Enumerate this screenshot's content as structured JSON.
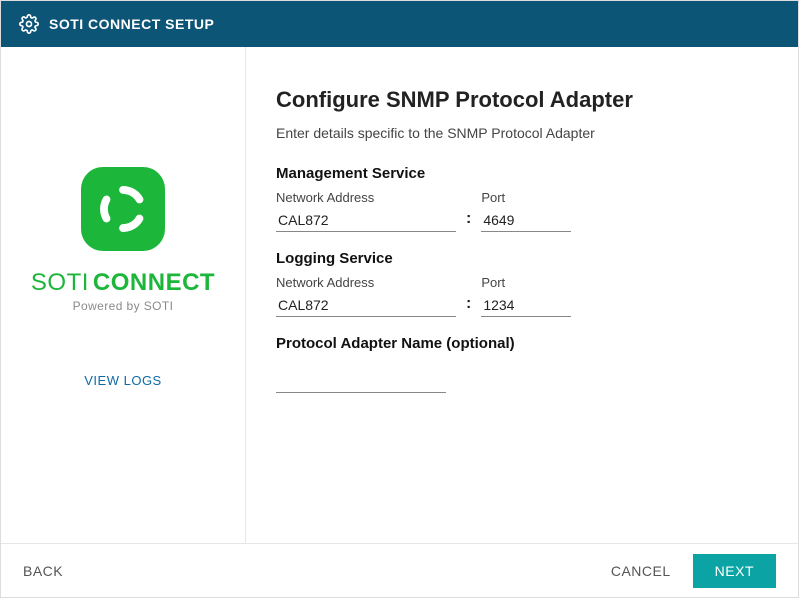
{
  "header": {
    "title": "SOTI CONNECT SETUP"
  },
  "sidebar": {
    "brand_soti": "SOTI",
    "brand_connect": "CONNECT",
    "powered": "Powered by SOTI",
    "view_logs": "VIEW LOGS"
  },
  "main": {
    "title": "Configure SNMP Protocol Adapter",
    "subtitle": "Enter details specific to the SNMP Protocol Adapter",
    "management": {
      "heading": "Management Service",
      "addr_label": "Network Address",
      "addr_value": "CAL872",
      "port_label": "Port",
      "port_value": "4649"
    },
    "logging": {
      "heading": "Logging Service",
      "addr_label": "Network Address",
      "addr_value": "CAL872",
      "port_label": "Port",
      "port_value": "1234"
    },
    "adapter_name": {
      "heading": "Protocol Adapter Name (optional)",
      "value": ""
    }
  },
  "footer": {
    "back": "BACK",
    "cancel": "CANCEL",
    "next": "NEXT"
  }
}
